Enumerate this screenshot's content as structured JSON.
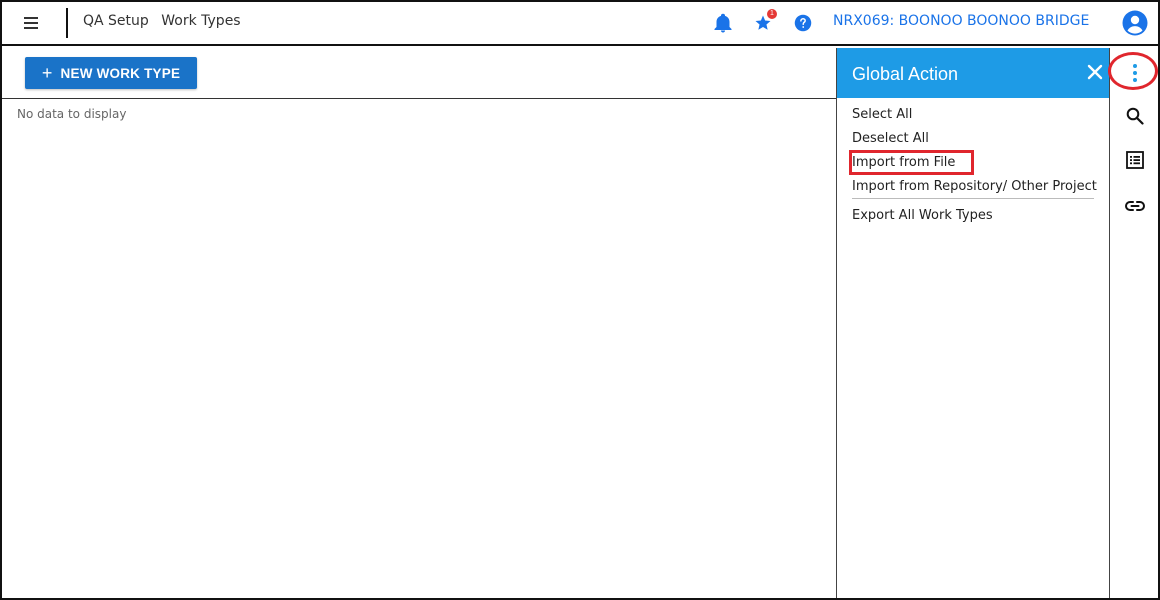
{
  "header": {
    "breadcrumb": [
      "QA Setup",
      "Work Types"
    ],
    "project": "NRX069: BOONOO BOONOO BRIDGE",
    "star_badge": "1",
    "icons": [
      "menu-icon",
      "bell-icon",
      "star-icon",
      "help-icon",
      "account-icon"
    ]
  },
  "toolbar": {
    "new_button_label": "NEW WORK TYPE"
  },
  "main": {
    "empty_message": "No data to display"
  },
  "global_action": {
    "title": "Global Action",
    "items": [
      "Select All",
      "Deselect All",
      "Import from File",
      "Import from Repository/ Other Project",
      "Export All Work Types"
    ]
  },
  "rail": {
    "icons": [
      "more-vert-icon",
      "search-icon",
      "list-icon",
      "link-icon"
    ]
  },
  "colors": {
    "primary": "#1a73c8",
    "panel_header": "#1e9be6",
    "link": "#1a73e8",
    "highlight": "#e0262d"
  }
}
